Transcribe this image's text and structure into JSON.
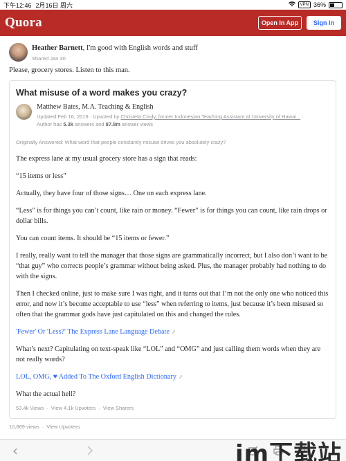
{
  "status_bar": {
    "time": "下午12:46",
    "date": "2月16日 周六",
    "vpn": "VPN",
    "battery": "36%",
    "battery_level": 0.36
  },
  "header": {
    "logo": "Quora",
    "open_in_app": "Open In App",
    "sign_in": "Sign In",
    "brand_color": "#b92b27",
    "accent_color": "#2e69ff"
  },
  "share": {
    "name": "Heather Barnett",
    "credential": ", I'm good with English words and stuff",
    "date": "Shared Jan 30",
    "comment": "Please, grocery stores. Listen to this man."
  },
  "answer": {
    "question": "What misuse of a word makes you crazy?",
    "author": "Matthew Bates, M.A. Teaching & English",
    "updated": "Updated Feb 16, 2019 · Upvoted by ",
    "upvoter": "Christela Cindy, former Indonesian Teaching Assistant at University of Hawai...",
    "author_has": " · Author has ",
    "answers_count": "5.3k",
    "answers_and": " answers and ",
    "answer_views": "87.8m",
    "answer_views_label": " answer views",
    "originally_answered": "Originally Answered: What word that people constantly misuse drives you absolutely crazy?",
    "paragraphs": [
      "The express lane at my usual grocery store has a sign that reads:",
      "“15 items or less”",
      "Actually, they have four of those signs… One on each express lane.",
      "“Less” is for things you can’t count, like rain or money. “Fewer” is for things you can count, like rain drops or dollar bills.",
      "You can count items. It should be “15 items or fewer.”",
      "I really, really want to tell the manager that those signs are grammatically incorrect, but I also don’t want to be “that guy” who corrects people’s grammar without being asked. Plus, the manager probably had nothing to do with the signs.",
      "Then I checked online, just to make sure I was right, and it turns out that I’m not the only one who noticed this error, and now it’s become acceptable to use “less” when referring to items, just because it’s been misused so often that the grammar gods have just capitulated on this and changed the rules.",
      "'Fewer' Or 'Less?' The Express Lane Language Debate",
      "What’s next? Capitulating on text-speak like “LOL” and “OMG” and just calling them words when they are not really words?",
      "LOL, OMG, ♥ Added To The Oxford English Dictionary",
      "What the actual hell?"
    ],
    "stats": {
      "views": "53.4k Views",
      "upvoters": "View 4.1k Upvoters",
      "sharers": "View Sharers",
      "sep": "·"
    }
  },
  "share_stats": {
    "views": "10,869 views",
    "upvoters": "View Upvoters",
    "sep": "·"
  },
  "toolbar": {
    "back": "‹",
    "watermark": "im下载站"
  }
}
